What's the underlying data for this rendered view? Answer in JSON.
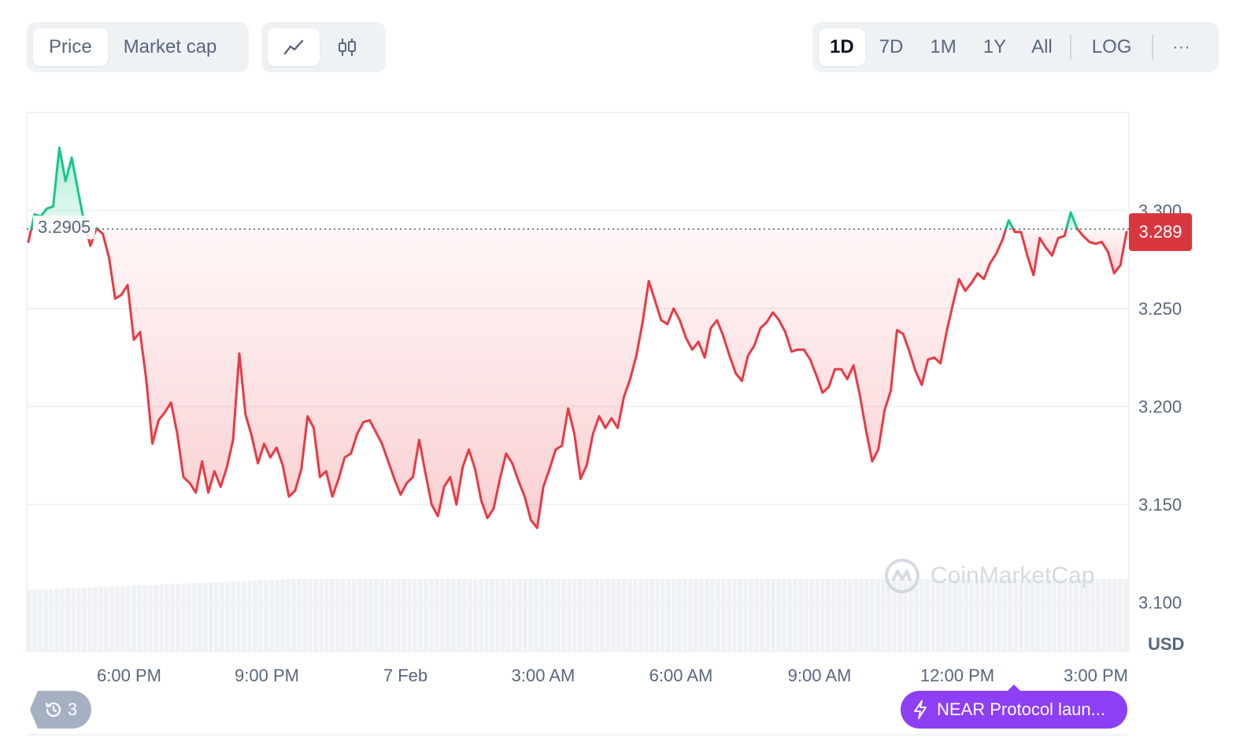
{
  "toolbar": {
    "metric_tabs": [
      {
        "label": "Price",
        "active": true
      },
      {
        "label": "Market cap",
        "active": false
      }
    ],
    "chart_type_tabs": [
      {
        "icon": "line-chart-icon",
        "active": true
      },
      {
        "icon": "candlestick-icon",
        "active": false
      }
    ],
    "range_tabs": [
      {
        "label": "1D",
        "active": true
      },
      {
        "label": "7D",
        "active": false
      },
      {
        "label": "1M",
        "active": false
      },
      {
        "label": "1Y",
        "active": false
      },
      {
        "label": "All",
        "active": false
      }
    ],
    "log_label": "LOG",
    "more_label": "···"
  },
  "chart_data": {
    "type": "area",
    "x_tick_labels": [
      "6:00 PM",
      "9:00 PM",
      "7 Feb",
      "3:00 AM",
      "6:00 AM",
      "9:00 AM",
      "12:00 PM",
      "3:00 PM"
    ],
    "y_tick_labels": [
      "3.300",
      "3.250",
      "3.200",
      "3.150",
      "3.100"
    ],
    "ylim": [
      3.075,
      3.35
    ],
    "y_axis_unit": "USD",
    "reference_price": 3.2905,
    "reference_label": "3.2905",
    "current_price": 3.289,
    "current_price_label": "3.289",
    "colors": {
      "up": "#16c784",
      "down": "#ea3943",
      "tag": "#d9373e"
    },
    "grid": true,
    "series": [
      {
        "values": [
          3.284,
          3.298,
          3.297,
          3.301,
          3.302,
          3.332,
          3.315,
          3.327,
          3.31,
          3.294,
          3.282,
          3.291,
          3.288,
          3.276,
          3.255,
          3.257,
          3.262,
          3.234,
          3.238,
          3.214,
          3.181,
          3.193,
          3.197,
          3.202,
          3.186,
          3.164,
          3.161,
          3.156,
          3.172,
          3.156,
          3.167,
          3.159,
          3.169,
          3.183,
          3.227,
          3.196,
          3.185,
          3.171,
          3.181,
          3.174,
          3.179,
          3.17,
          3.154,
          3.157,
          3.168,
          3.195,
          3.189,
          3.164,
          3.167,
          3.154,
          3.163,
          3.174,
          3.176,
          3.186,
          3.192,
          3.193,
          3.187,
          3.181,
          3.172,
          3.163,
          3.155,
          3.161,
          3.164,
          3.183,
          3.166,
          3.15,
          3.144,
          3.159,
          3.164,
          3.15,
          3.169,
          3.178,
          3.168,
          3.152,
          3.143,
          3.148,
          3.163,
          3.176,
          3.171,
          3.162,
          3.154,
          3.142,
          3.138,
          3.159,
          3.168,
          3.178,
          3.18,
          3.199,
          3.186,
          3.163,
          3.17,
          3.186,
          3.195,
          3.189,
          3.194,
          3.189,
          3.205,
          3.214,
          3.226,
          3.243,
          3.264,
          3.254,
          3.244,
          3.242,
          3.25,
          3.244,
          3.235,
          3.229,
          3.233,
          3.225,
          3.24,
          3.244,
          3.236,
          3.226,
          3.217,
          3.213,
          3.226,
          3.231,
          3.24,
          3.243,
          3.248,
          3.244,
          3.238,
          3.228,
          3.229,
          3.229,
          3.224,
          3.216,
          3.207,
          3.21,
          3.219,
          3.219,
          3.214,
          3.221,
          3.206,
          3.188,
          3.172,
          3.178,
          3.198,
          3.208,
          3.239,
          3.237,
          3.228,
          3.218,
          3.211,
          3.224,
          3.225,
          3.222,
          3.238,
          3.252,
          3.265,
          3.259,
          3.263,
          3.268,
          3.265,
          3.273,
          3.278,
          3.285,
          3.295,
          3.289,
          3.289,
          3.277,
          3.267,
          3.286,
          3.281,
          3.277,
          3.286,
          3.287,
          3.299,
          3.291,
          3.287,
          3.284,
          3.283,
          3.284,
          3.279,
          3.268,
          3.272,
          3.289
        ]
      }
    ]
  },
  "badges": {
    "history_count": "3",
    "event_label": "NEAR Protocol laun..."
  },
  "watermark": "CoinMarketCap"
}
